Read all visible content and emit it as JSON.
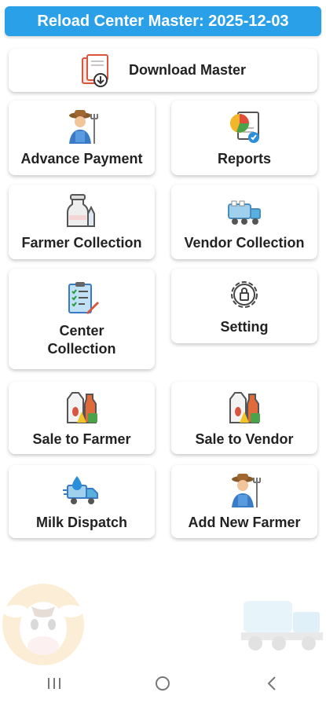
{
  "header": {
    "title": "Reload Center Master: 2025-12-03"
  },
  "download": {
    "label": "Download Master",
    "icon": "document-download-icon"
  },
  "tiles": [
    {
      "label": "Advance Payment",
      "icon": "farmer-icon"
    },
    {
      "label": "Reports",
      "icon": "pie-chart-report-icon"
    },
    {
      "label": "Farmer Collection",
      "icon": "milk-can-icon"
    },
    {
      "label": "Vendor Collection",
      "icon": "milk-truck-icon"
    },
    {
      "label": "Center Collection",
      "icon": "checklist-icon"
    },
    {
      "label": "Setting",
      "icon": "gear-icon"
    },
    {
      "label": "Sale to Farmer",
      "icon": "dairy-products-icon"
    },
    {
      "label": "Sale to Vendor",
      "icon": "dairy-products-icon"
    },
    {
      "label": "Milk Dispatch",
      "icon": "delivery-truck-icon"
    },
    {
      "label": "Add New Farmer",
      "icon": "farmer-icon"
    }
  ],
  "colors": {
    "header_bg": "#2aa0e8",
    "accent": "#2aa0e8"
  },
  "nav": {
    "icons": [
      "recent-apps-icon",
      "home-icon",
      "back-icon"
    ]
  }
}
